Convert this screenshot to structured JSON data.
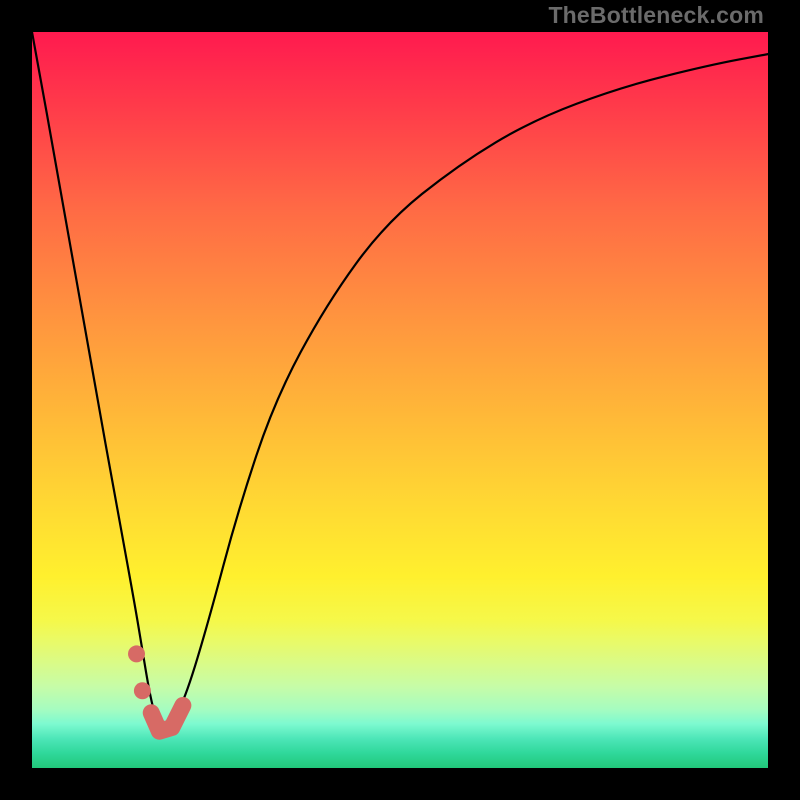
{
  "watermark": "TheBottleneck.com",
  "colors": {
    "frame": "#000000",
    "curve": "#000000",
    "marker": "#d76a65"
  },
  "chart_data": {
    "type": "line",
    "title": "",
    "xlabel": "",
    "ylabel": "",
    "xlim": [
      0,
      100
    ],
    "ylim": [
      0,
      100
    ],
    "grid": false,
    "legend": false,
    "x": [
      0,
      4,
      8,
      12,
      14,
      15,
      16,
      17,
      18,
      19,
      21,
      24,
      28,
      33,
      40,
      48,
      58,
      68,
      80,
      92,
      100
    ],
    "values": [
      100,
      78,
      55,
      33,
      22,
      16,
      10,
      6,
      5,
      6,
      10,
      20,
      35,
      50,
      63,
      74,
      82,
      88,
      92.5,
      95.5,
      97
    ],
    "markers": {
      "dots": [
        {
          "x": 14.2,
          "y": 15.5
        },
        {
          "x": 15.0,
          "y": 10.5
        }
      ],
      "stroke_path": [
        {
          "x": 16.2,
          "y": 7.5
        },
        {
          "x": 17.3,
          "y": 5.0
        },
        {
          "x": 19.0,
          "y": 5.5
        },
        {
          "x": 20.5,
          "y": 8.5
        }
      ]
    }
  }
}
